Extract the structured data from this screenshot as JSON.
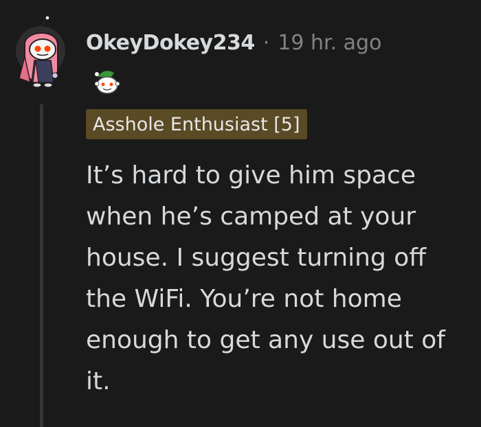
{
  "comment": {
    "username": "OkeyDokey234",
    "separator": "·",
    "timestamp": "19 hr. ago",
    "flair": "Asshole Enthusiast [5]",
    "body": "It’s hard to give him space when he’s camped at your house. I suggest turning off the WiFi. You’re not home enough to get any use out of it.",
    "avatar_icon": "snoo-avatar-pink-hood",
    "award_icon": "snoo-elf-hat-award"
  },
  "colors": {
    "background": "#1a1a1b",
    "text": "#d7dadc",
    "meta": "#818384",
    "flair_bg": "#5a4a25",
    "thread_line": "#343536"
  }
}
